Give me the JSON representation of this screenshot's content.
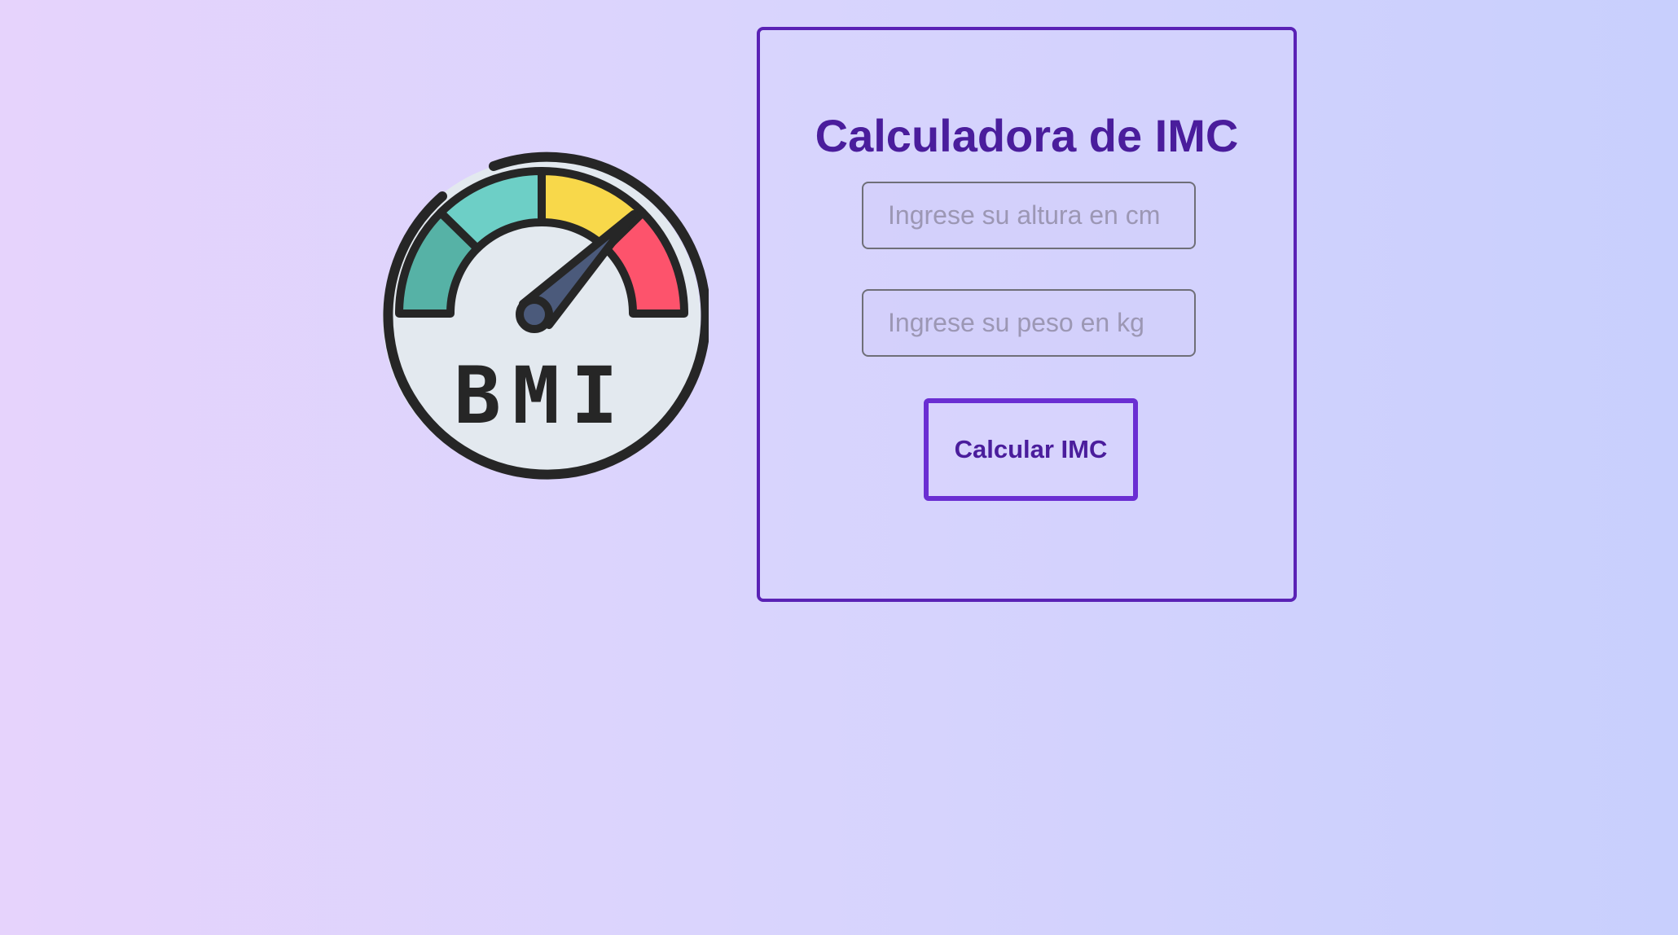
{
  "logo": {
    "icon": "bmi-gauge-icon",
    "text": "BMI",
    "colors": {
      "dial_face": "#e3e9ef",
      "outline": "#262626",
      "segment_green": "#56b2a6",
      "segment_teal": "#6dcfc6",
      "segment_yellow": "#f8d84a",
      "segment_red": "#fd536c",
      "needle": "#4b5a7b"
    }
  },
  "calculator": {
    "title": "Calculadora de IMC",
    "height_input": {
      "placeholder": "Ingrese su altura en cm",
      "value": ""
    },
    "weight_input": {
      "placeholder": "Ingrese su peso en kg",
      "value": ""
    },
    "submit_label": "Calcular IMC"
  },
  "colors": {
    "accent": "#5a22b5",
    "title": "#4a1d9c",
    "background_start": "#e6d3fc",
    "background_end": "#c8cffd"
  }
}
